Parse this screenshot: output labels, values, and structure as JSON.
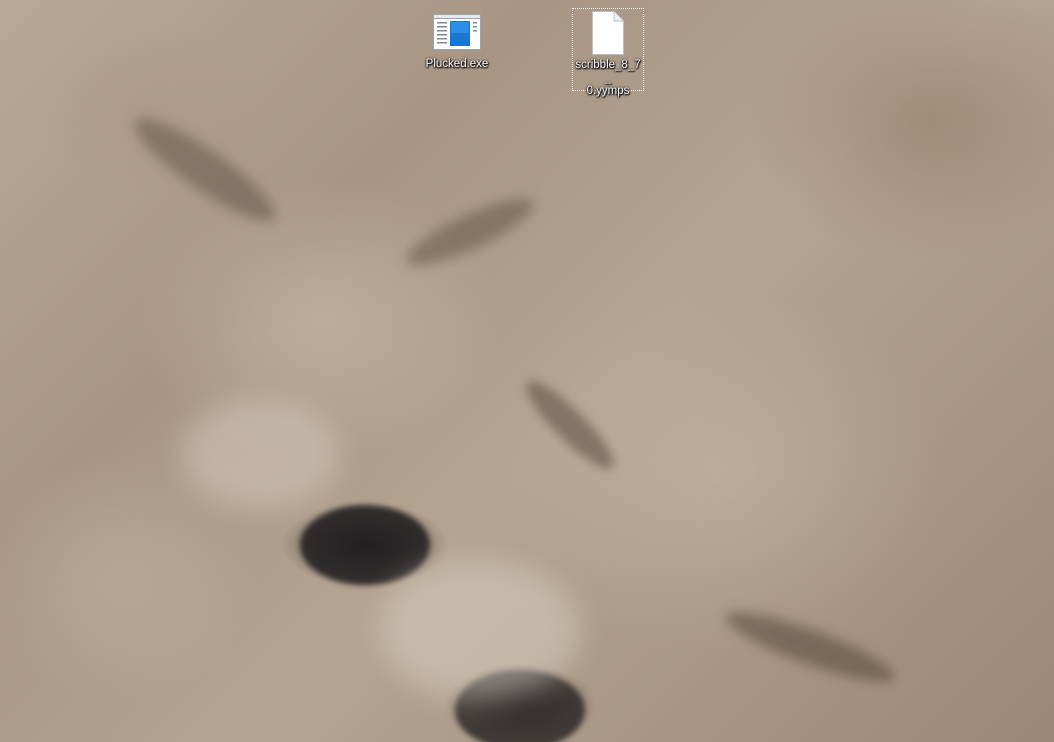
{
  "desktop": {
    "wallpaper": "fennec-foxes-sleeping",
    "icons": [
      {
        "label": "Plucked.exe",
        "icon": "application-window-icon",
        "selected": false
      },
      {
        "label": "scribble_8_7_0.yymps",
        "line1": "scribble_8_7_",
        "line2": "0.yymps",
        "icon": "blank-document-icon",
        "selected": true
      }
    ]
  },
  "colors": {
    "label_text": "#ffffff",
    "app_icon_accent": "#1976d2"
  }
}
